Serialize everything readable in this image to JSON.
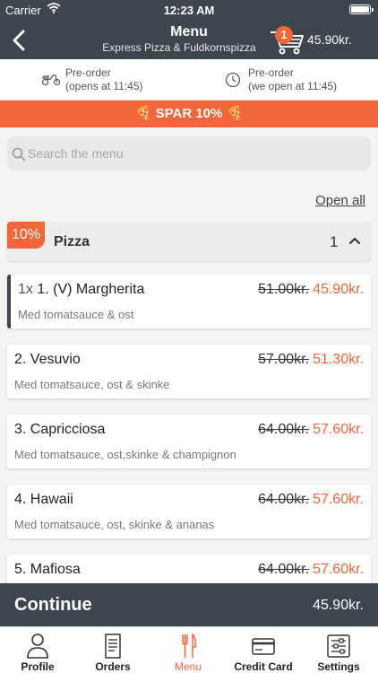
{
  "status_bar": {
    "carrier": "Carrier",
    "time": "12:23 AM"
  },
  "header": {
    "title": "Menu",
    "subtitle": "Express Pizza & Fuldkornspizza",
    "cart_count": "1",
    "cart_total": "45.90kr."
  },
  "preorder": {
    "delivery": {
      "line1": "Pre-order",
      "line2": "(opens at 11:45)",
      "icon": "scooter-icon"
    },
    "pickup": {
      "line1": "Pre-order",
      "line2": "(we open at 11:45)",
      "icon": "clock-icon"
    }
  },
  "promo": {
    "text": "🍕 SPAR 10% 🍕"
  },
  "search": {
    "placeholder": "Search the menu"
  },
  "open_all": "Open all",
  "category": {
    "badge": "10%",
    "name": "Pizza",
    "count": "1"
  },
  "items": [
    {
      "qty": "1x ",
      "name": "1. (V) Margherita",
      "desc": "Med tomatsauce & ost",
      "old_price": "51.00kr.",
      "new_price": "45.90kr."
    },
    {
      "qty": "",
      "name": "2.  Vesuvio",
      "desc": "Med tomatsauce, ost & skinke",
      "old_price": "57.00kr.",
      "new_price": "51.30kr."
    },
    {
      "qty": "",
      "name": "3. Capricciosa",
      "desc": "Med tomatsauce, ost,skinke & champignon",
      "old_price": "64.00kr.",
      "new_price": "57.60kr."
    },
    {
      "qty": "",
      "name": "4. Hawaii",
      "desc": "Med tomatsauce, ost, skinke & ananas",
      "old_price": "64.00kr.",
      "new_price": "57.60kr."
    },
    {
      "qty": "",
      "name": "5. Mafiosa",
      "desc": "",
      "old_price": "64.00kr.",
      "new_price": "57.60kr."
    }
  ],
  "continue": {
    "label": "Continue",
    "total": "45.90kr."
  },
  "tabs": [
    {
      "label": "Profile",
      "icon": "profile-icon"
    },
    {
      "label": "Orders",
      "icon": "orders-icon"
    },
    {
      "label": "Menu",
      "icon": "menu-cutlery-icon"
    },
    {
      "label": "Credit Card",
      "icon": "credit-card-icon"
    },
    {
      "label": "Settings",
      "icon": "settings-sliders-icon"
    }
  ],
  "colors": {
    "accent": "#f2663c",
    "header_bg": "#3f454d",
    "page_bg": "#f4f4f4"
  }
}
